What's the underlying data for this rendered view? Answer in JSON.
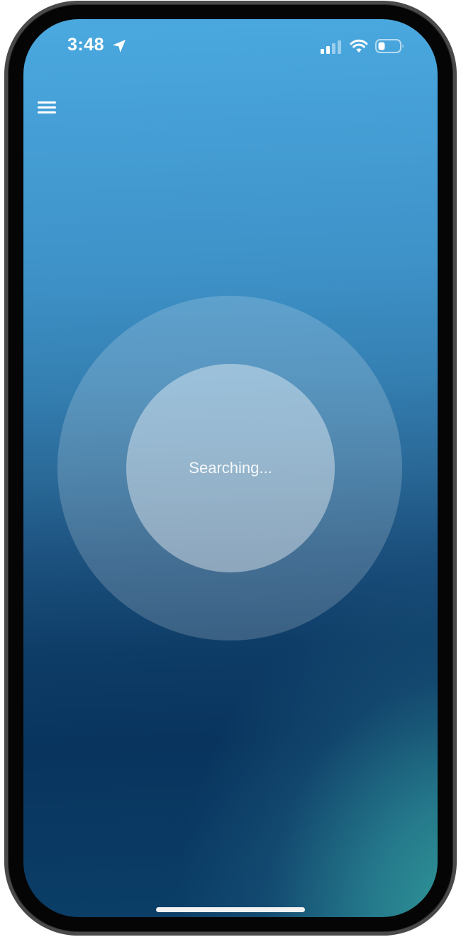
{
  "status_bar": {
    "time": "3:48",
    "icons": [
      "location-arrow-icon",
      "cellular-signal-icon",
      "wifi-icon",
      "battery-icon"
    ]
  },
  "header": {
    "menu_icon": "hamburger-menu-icon"
  },
  "main": {
    "status_text": "Searching..."
  },
  "colors": {
    "gradient_top": "#4aa9df",
    "gradient_bottom": "#08345e",
    "gradient_accent_teal": "#319c9a",
    "text": "#ffffff"
  }
}
